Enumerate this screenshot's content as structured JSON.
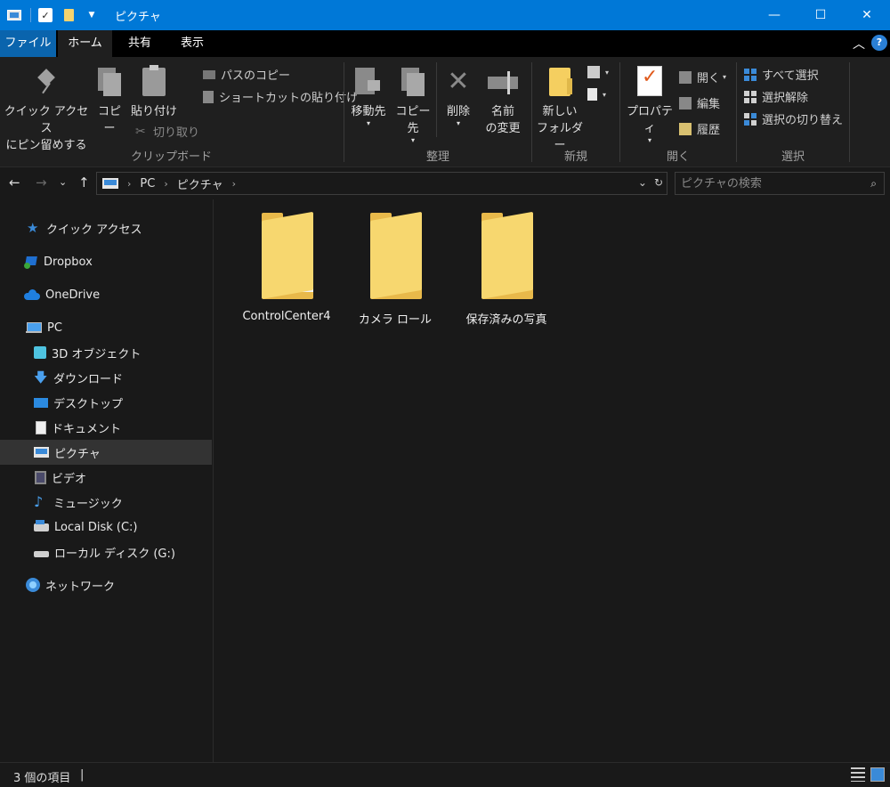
{
  "window": {
    "title": "ピクチャ",
    "minimize_glyph": "—",
    "maximize_glyph": "☐",
    "close_glyph": "✕"
  },
  "menu": {
    "tabs": [
      "ファイル",
      "ホーム",
      "共有",
      "表示"
    ],
    "selected": "ホーム",
    "help_glyph": "?"
  },
  "ribbon": {
    "clipboard": {
      "label": "クリップボード",
      "pin_line1": "クイック アクセス",
      "pin_line2": "にピン留めする",
      "copy": "コピー",
      "paste": "貼り付け",
      "copy_path": "パスのコピー",
      "paste_shortcut": "ショートカットの貼り付け",
      "cut": "切り取り"
    },
    "organize": {
      "label": "整理",
      "move_to": "移動先",
      "copy_to": "コピー先",
      "delete": "削除",
      "rename_line1": "名前",
      "rename_line2": "の変更"
    },
    "new": {
      "label": "新規",
      "new_folder_line1": "新しい",
      "new_folder_line2": "フォルダー"
    },
    "open": {
      "label": "開く",
      "properties": "プロパティ",
      "open": "開く",
      "edit": "編集",
      "history": "履歴"
    },
    "select": {
      "label": "選択",
      "select_all": "すべて選択",
      "select_none": "選択解除",
      "invert": "選択の切り替え"
    }
  },
  "address": {
    "crumbs": [
      "PC",
      "ピクチャ"
    ],
    "search_placeholder": "ピクチャの検索"
  },
  "sidebar": {
    "items": [
      {
        "label": "クイック アクセス",
        "icon": "star-icon"
      },
      {
        "label": "Dropbox",
        "icon": "dropbox-icon"
      },
      {
        "label": "OneDrive",
        "icon": "cloud-icon"
      },
      {
        "label": "PC",
        "icon": "pc-icon"
      },
      {
        "label": "3D オブジェクト",
        "icon": "3d-objects-icon"
      },
      {
        "label": "ダウンロード",
        "icon": "download-icon"
      },
      {
        "label": "デスクトップ",
        "icon": "desktop-icon"
      },
      {
        "label": "ドキュメント",
        "icon": "document-icon"
      },
      {
        "label": "ピクチャ",
        "icon": "pictures-icon"
      },
      {
        "label": "ビデオ",
        "icon": "video-icon"
      },
      {
        "label": "ミュージック",
        "icon": "music-icon"
      },
      {
        "label": "Local Disk (C:)",
        "icon": "disk-icon"
      },
      {
        "label": "ローカル ディスク (G:)",
        "icon": "removable-disk-icon"
      },
      {
        "label": "ネットワーク",
        "icon": "network-icon"
      }
    ],
    "selected": "ピクチャ"
  },
  "files": [
    {
      "name": "ControlCenter4",
      "icon": "folder-with-content-icon"
    },
    {
      "name": "カメラ ロール",
      "icon": "folder-icon"
    },
    {
      "name": "保存済みの写真",
      "icon": "folder-icon"
    }
  ],
  "status": {
    "item_count": "3 個の項目"
  },
  "colors": {
    "titlebar": "#0078d7",
    "background": "#191919",
    "ribbon": "#1f1f1f",
    "folder": "#f7d76f",
    "selection": "#333333"
  }
}
